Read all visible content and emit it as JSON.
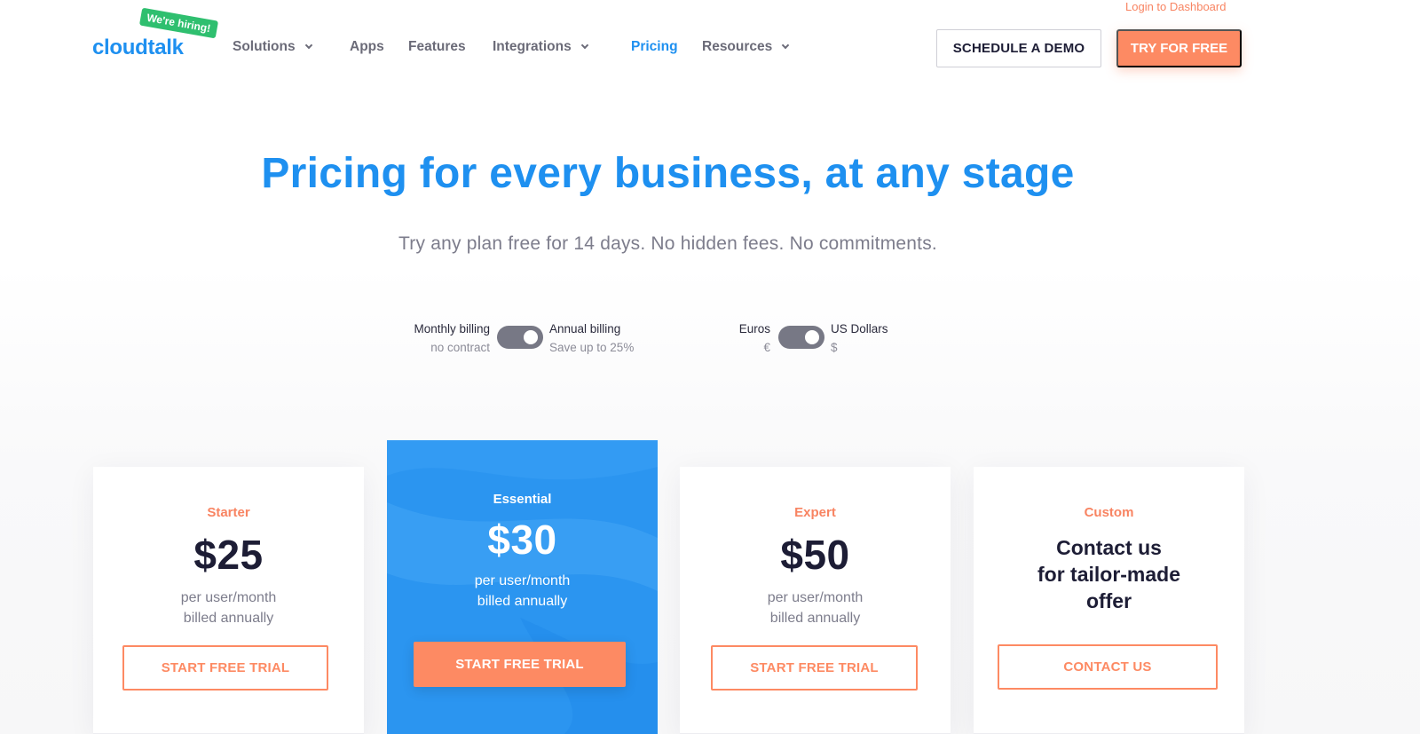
{
  "header": {
    "login_link": "Login to Dashboard",
    "logo_text": "cloudtalk",
    "hiring_badge": "We're hiring!",
    "nav": [
      {
        "label": "Solutions",
        "has_dropdown": true,
        "active": false
      },
      {
        "label": "Apps",
        "has_dropdown": false,
        "active": false
      },
      {
        "label": "Features",
        "has_dropdown": false,
        "active": false
      },
      {
        "label": "Integrations",
        "has_dropdown": true,
        "active": false
      },
      {
        "label": "Pricing",
        "has_dropdown": false,
        "active": true
      },
      {
        "label": "Resources",
        "has_dropdown": true,
        "active": false
      }
    ],
    "schedule_demo_label": "SCHEDULE A DEMO",
    "try_free_label": "TRY FOR FREE"
  },
  "hero": {
    "title": "Pricing for every business, at any stage",
    "subtitle": "Try any plan free for 14 days. No hidden fees. No commitments."
  },
  "billing_toggle": {
    "left_label": "Monthly billing",
    "left_sub": "no contract",
    "right_label": "Annual billing",
    "right_sub": "Save up to 25%",
    "selected": "Annual billing"
  },
  "currency_toggle": {
    "left_label": "Euros",
    "left_sub": "€",
    "right_label": "US Dollars",
    "right_sub": "$",
    "selected": "US Dollars"
  },
  "plans": [
    {
      "name": "Starter",
      "price": "$25",
      "note_line1": "per user/month",
      "note_line2": "billed annually",
      "button": "START FREE TRIAL"
    },
    {
      "name": "Essential",
      "price": "$30",
      "note_line1": "per user/month",
      "note_line2": "billed annually",
      "button": "START FREE TRIAL"
    },
    {
      "name": "Expert",
      "price": "$50",
      "note_line1": "per user/month",
      "note_line2": "billed annually",
      "button": "START FREE TRIAL"
    },
    {
      "name": "Custom",
      "contact_line1": "Contact us",
      "contact_line2": "for tailor-made",
      "contact_line3": "offer",
      "button": "CONTACT US"
    }
  ],
  "colors": {
    "brand_blue": "#1e90f0",
    "accent_orange": "#fd8a63",
    "badge_green": "#2fbf6f",
    "featured_card": "#2b95f0"
  }
}
